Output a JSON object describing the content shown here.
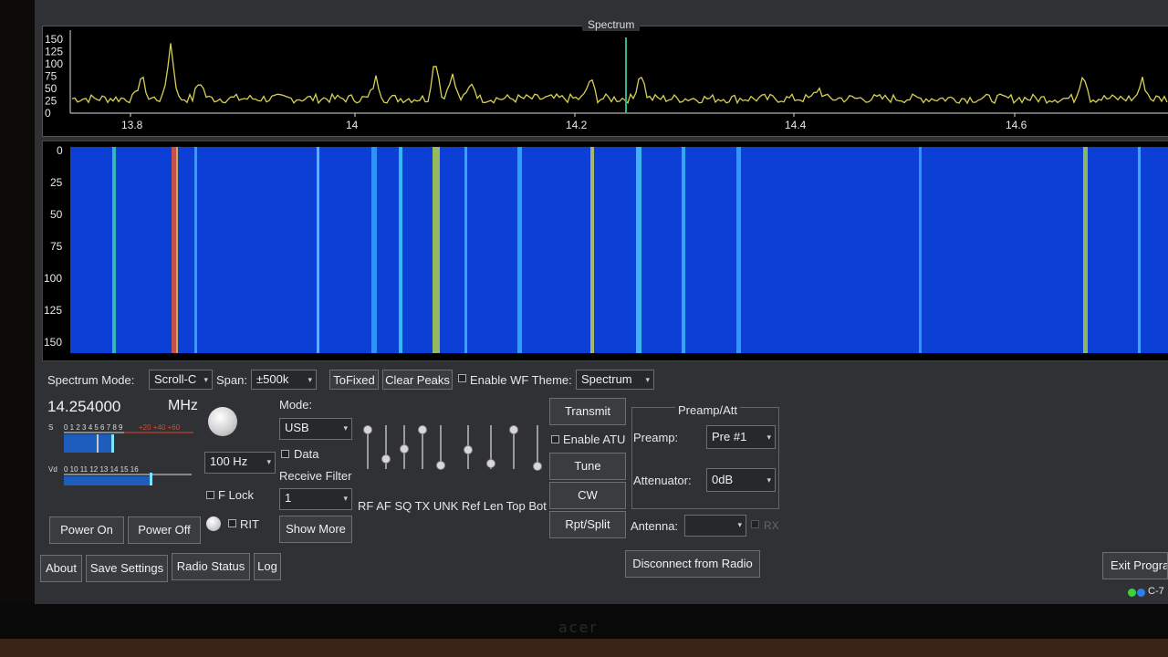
{
  "spectrum": {
    "title": "Spectrum",
    "y_ticks": [
      "150",
      "125",
      "100",
      "75",
      "50",
      "25",
      "0"
    ],
    "x_ticks": [
      "13.8",
      "14",
      "14.2",
      "14.4",
      "14.6"
    ]
  },
  "waterfall": {
    "y_ticks": [
      "0",
      "25",
      "50",
      "75",
      "100",
      "125",
      "150"
    ]
  },
  "controls": {
    "spectrum_mode_label": "Spectrum Mode:",
    "spectrum_mode_value": "Scroll-C",
    "span_label": "Span:",
    "span_value": "±500k",
    "to_fixed": "ToFixed",
    "clear_peaks": "Clear Peaks",
    "enable_wf_theme": "Enable WF Theme:",
    "theme_value": "Spectrum",
    "frequency": "14.254000",
    "frequency_unit": "MHz",
    "mode_label": "Mode:",
    "mode_value": "USB",
    "data_label": "Data",
    "receive_filter_label": "Receive Filter",
    "receive_filter_value": "1",
    "step_value": "100 Hz",
    "f_lock": "F Lock",
    "rit": "RIT",
    "power_on": "Power On",
    "power_off": "Power Off",
    "show_more": "Show More",
    "slider_labels": "RF AF SQ TX UNK Ref Len Top Bot",
    "transmit": "Transmit",
    "enable_atu": "Enable ATU",
    "tune": "Tune",
    "cw": "CW",
    "rpt_split": "Rpt/Split",
    "preamp_group": "Preamp/Att",
    "preamp_label": "Preamp:",
    "preamp_value": "Pre #1",
    "attenuator_label": "Attenuator:",
    "attenuator_value": "0dB",
    "antenna_label": "Antenna:",
    "antenna_value": "",
    "rx_label": "RX",
    "s_meter_label": "S",
    "s_meter_scale": "0 1 2 3 4 5 6 7 8 9",
    "s_meter_over": "+20  +40  +60",
    "vd_meter_label": "Vd",
    "vd_meter_scale": "0 10    11    12    13    14    15   16"
  },
  "footer": {
    "about": "About",
    "save_settings": "Save Settings",
    "radio_status": "Radio Status",
    "log": "Log",
    "disconnect": "Disconnect from Radio",
    "exit": "Exit Progra",
    "status_text": "C-7"
  },
  "colors": {
    "trace": "#d8cf54",
    "marker": "#2fb58a",
    "waterfall_bg": "#0b3fd6",
    "status_green": "#39d439",
    "status_blue": "#2e7ef0"
  }
}
